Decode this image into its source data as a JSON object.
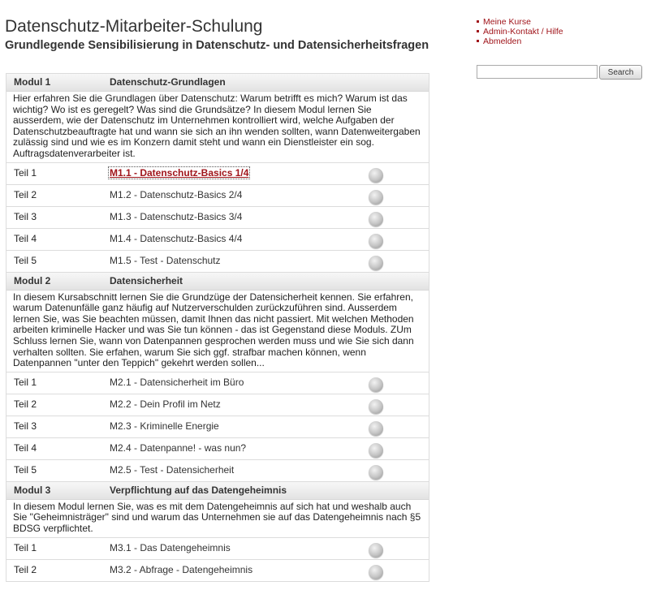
{
  "header": {
    "title": "Datenschutz-Mitarbeiter-Schulung",
    "subtitle": "Grundlegende Sensibilisierung in Datenschutz- und Datensicherheitsfragen"
  },
  "toplinks": [
    "Meine Kurse",
    "Admin-Kontakt / Hilfe",
    "Abmelden"
  ],
  "search": {
    "value": "",
    "button_label": "Search"
  },
  "modules": [
    {
      "label": "Modul 1",
      "name": "Datenschutz-Grundlagen",
      "description": "Hier erfahren Sie die Grundlagen über Datenschutz: Warum betrifft es mich? Warum ist das wichtig? Wo ist es geregelt? Was sind die Grundsätze? In diesem Modul lernen Sie ausserdem, wie der Datenschutz im Unternehmen kontrolliert wird, welche Aufgaben der Datenschutzbeauftragte hat und wann sie sich an ihn wenden sollten, wann Datenweitergaben zulässig sind und wie es im Konzern damit steht und wann ein Dienstleister ein sog. Auftragsdatenverarbeiter ist.",
      "parts": [
        {
          "num": "Teil 1",
          "title": "M1.1 - Datenschutz-Basics 1/4",
          "active": true
        },
        {
          "num": "Teil 2",
          "title": "M1.2 - Datenschutz-Basics 2/4"
        },
        {
          "num": "Teil 3",
          "title": "M1.3 - Datenschutz-Basics 3/4"
        },
        {
          "num": "Teil 4",
          "title": "M1.4 - Datenschutz-Basics 4/4"
        },
        {
          "num": "Teil 5",
          "title": "M1.5 - Test - Datenschutz"
        }
      ]
    },
    {
      "label": "Modul 2",
      "name": "Datensicherheit",
      "description": "In diesem Kursabschnitt lernen Sie die Grundzüge der Datensicherheit kennen. Sie erfahren, warum Datenunfälle ganz häufig auf Nutzerverschulden zurückzuführen sind. Ausserdem lernen Sie, was Sie beachten müssen, damit Ihnen das nicht passiert. Mit welchen Methoden arbeiten kriminelle Hacker und was Sie tun können - das ist Gegenstand diese Moduls. ZUm Schluss lernen Sie, wann von Datenpannen gesprochen werden muss und wie Sie sich dann verhalten sollten. Sie erfahen, warum Sie sich ggf. strafbar machen können, wenn Datenpannen \"unter den Teppich\" gekehrt werden sollen...",
      "parts": [
        {
          "num": "Teil 1",
          "title": "M2.1 - Datensicherheit im Büro"
        },
        {
          "num": "Teil 2",
          "title": "M2.2 - Dein Profil im Netz"
        },
        {
          "num": "Teil 3",
          "title": "M2.3 - Kriminelle Energie"
        },
        {
          "num": "Teil 4",
          "title": "M2.4 - Datenpanne! - was nun?"
        },
        {
          "num": "Teil 5",
          "title": "M2.5 - Test - Datensicherheit"
        }
      ]
    },
    {
      "label": "Modul 3",
      "name": "Verpflichtung auf das Datengeheimnis",
      "description": "In diesem Modul lernen Sie, was es mit dem Datengeheimnis auf sich hat und weshalb auch Sie \"Geheimnisträger\" sind und warum das Unternehmen sie auf das Datengeheimnis nach §5 BDSG verpflichtet.",
      "parts": [
        {
          "num": "Teil 1",
          "title": "M3.1 - Das Datengeheimnis"
        },
        {
          "num": "Teil 2",
          "title": "M3.2 - Abfrage - Datengeheimnis"
        }
      ]
    }
  ]
}
